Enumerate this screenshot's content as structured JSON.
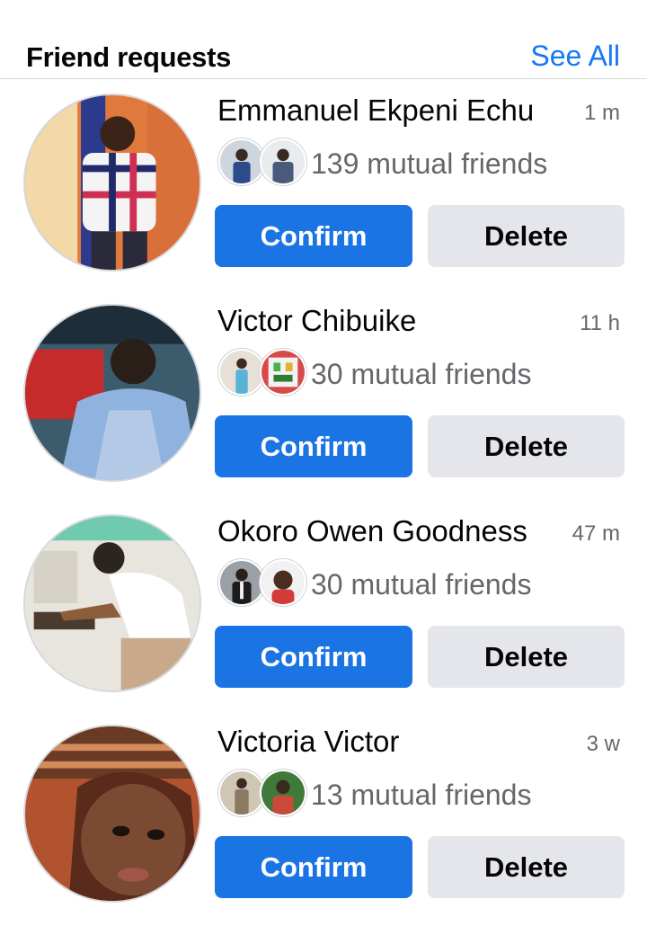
{
  "header": {
    "title": "Friend requests",
    "see_all": "See All"
  },
  "requests": [
    {
      "name": "Emmanuel Ekpeni Echu",
      "time": "1 m",
      "mutual": "139 mutual friends",
      "confirm": "Confirm",
      "delete": "Delete",
      "avatar_colors": [
        "#e07a3c",
        "#f3d9a8",
        "#2b3a8c",
        "#cf2f52"
      ]
    },
    {
      "name": "Victor Chibuike",
      "time": "11 h",
      "mutual": "30 mutual friends",
      "confirm": "Confirm",
      "delete": "Delete",
      "avatar_colors": [
        "#2f6fb5",
        "#b4c9e6",
        "#c52b2b",
        "#2a1e18"
      ]
    },
    {
      "name": "Okoro Owen Goodness",
      "time": "47 m",
      "mutual": "30 mutual friends",
      "confirm": "Confirm",
      "delete": "Delete",
      "avatar_colors": [
        "#6fcab0",
        "#e8e4de",
        "#2b2420",
        "#c9a98c"
      ]
    },
    {
      "name": "Victoria Victor",
      "time": "3 w",
      "mutual": "13 mutual friends",
      "confirm": "Confirm",
      "delete": "Delete",
      "avatar_colors": [
        "#b0532e",
        "#5a2a1a",
        "#6b3a25",
        "#e8c7b4"
      ]
    }
  ]
}
